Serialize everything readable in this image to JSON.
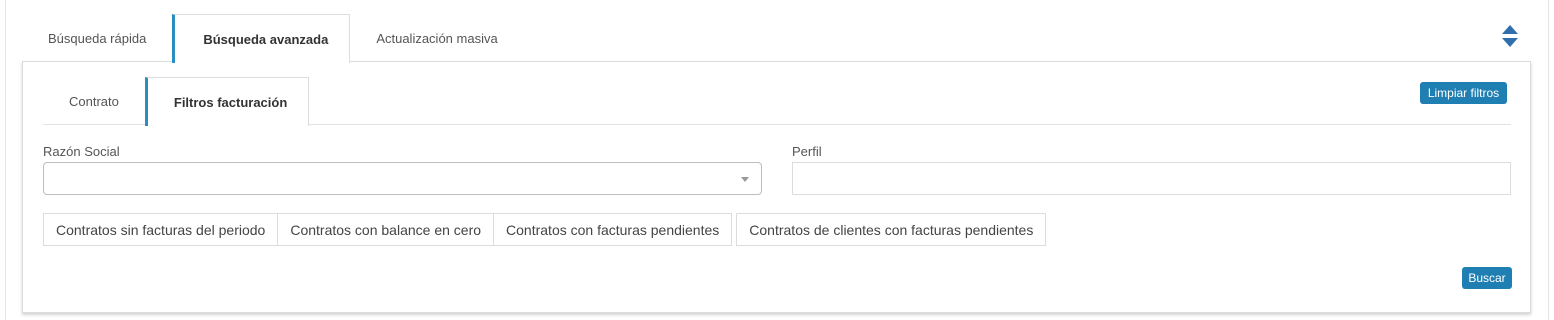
{
  "top_tabs": [
    {
      "label": "Búsqueda rápida"
    },
    {
      "label": "Búsqueda avanzada"
    },
    {
      "label": "Actualización masiva"
    }
  ],
  "inner_tabs": [
    {
      "label": "Contrato"
    },
    {
      "label": "Filtros facturación"
    }
  ],
  "clear_filters_label": "Limpiar filtros",
  "fields": {
    "razon_social": {
      "label": "Razón Social",
      "value": ""
    },
    "perfil": {
      "label": "Perfil",
      "value": ""
    }
  },
  "filter_buttons": [
    {
      "label": "Contratos sin facturas del periodo"
    },
    {
      "label": "Contratos con balance en cero"
    },
    {
      "label": "Contratos con facturas pendientes"
    },
    {
      "label": "Contratos de clientes con facturas pendientes"
    }
  ],
  "search_label": "Buscar",
  "colors": {
    "accent": "#2a8fc0",
    "button": "#1f7fb3",
    "toggle_icon": "#2f6fae"
  },
  "icons": {
    "sort_toggle": "sort-up-down-icon",
    "select_caret": "chevron-down-icon"
  }
}
